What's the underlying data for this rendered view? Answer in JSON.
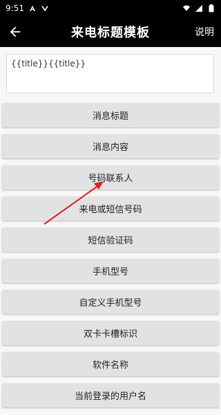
{
  "status_bar": {
    "time": "9:51"
  },
  "app_bar": {
    "title": "来电标题模板",
    "help_label": "说明"
  },
  "template_input": {
    "value": "{{title}}{{title}}"
  },
  "buttons": [
    {
      "label": "消息标题"
    },
    {
      "label": "消息内容"
    },
    {
      "label": "号码联系人"
    },
    {
      "label": "来电或短信号码"
    },
    {
      "label": "短信验证码"
    },
    {
      "label": "手机型号"
    },
    {
      "label": "自定义手机型号"
    },
    {
      "label": "双卡卡槽标识"
    },
    {
      "label": "软件名称"
    },
    {
      "label": "当前登录的用户名"
    }
  ],
  "colors": {
    "bar_bg": "#000000",
    "button_bg": "#e2e2e2",
    "annotation_arrow": "#e0201f"
  }
}
